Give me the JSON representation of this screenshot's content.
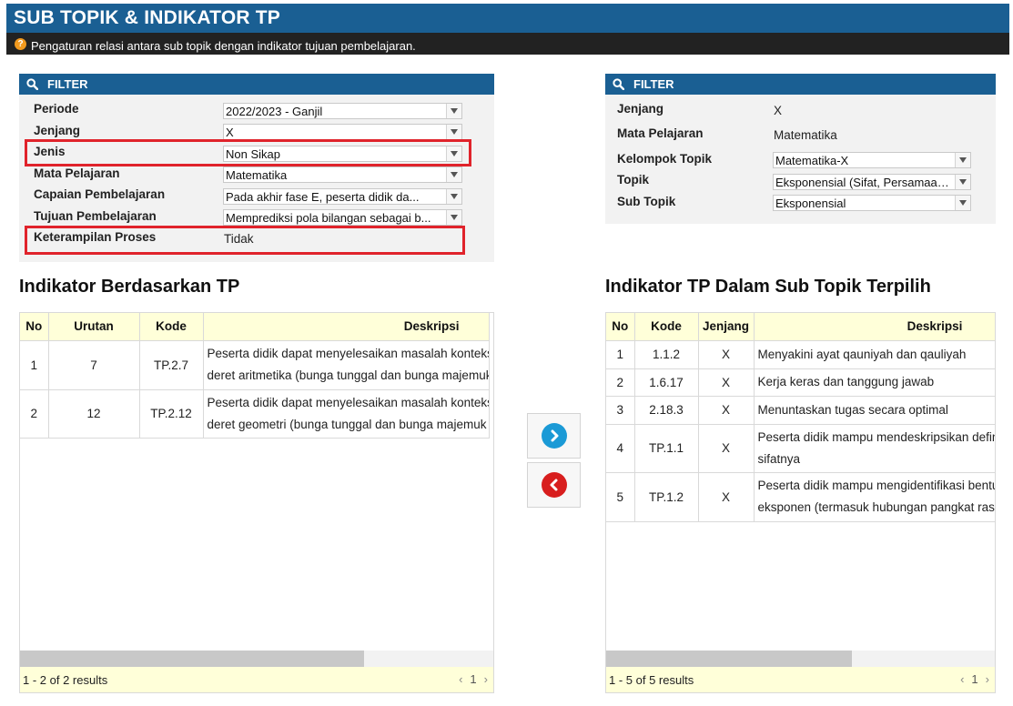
{
  "header": {
    "title": "SUB TOPIK & INDIKATOR TP",
    "help_icon": "question-circle-icon",
    "subtitle": "Pengaturan relasi antara sub topik dengan indikator tujuan pembelajaran."
  },
  "left_filter": {
    "title": "FILTER",
    "search_icon": "search-icon",
    "periode_label": "Periode",
    "periode_value": "2022/2023 - Ganjil",
    "jenjang_label": "Jenjang",
    "jenjang_value": "X",
    "jenis_label": "Jenis",
    "jenis_value": "Non Sikap",
    "mapel_label": "Mata Pelajaran",
    "mapel_value": "Matematika",
    "cp_label": "Capaian Pembelajaran",
    "cp_value": "Pada akhir fase E, peserta didik da...",
    "tp_label": "Tujuan Pembelajaran",
    "tp_value": "Memprediksi pola bilangan sebagai b...",
    "kp_label": "Keterampilan Proses",
    "kp_value": "Tidak",
    "highlight_color": "#e0232b"
  },
  "right_filter": {
    "title": "FILTER",
    "jenjang_label": "Jenjang",
    "jenjang_value": "X",
    "mapel_label": "Mata Pelajaran",
    "mapel_value": "Matematika",
    "kelompok_label": "Kelompok Topik",
    "kelompok_value": "Matematika-X",
    "topik_label": "Topik",
    "topik_value": "Eksponensial (Sifat, Persamaan...",
    "subtopik_label": "Sub Topik",
    "subtopik_value": "Eksponensial"
  },
  "left_grid": {
    "section_title": "Indikator Berdasarkan TP",
    "headers": {
      "no": "No",
      "urutan": "Urutan",
      "kode": "Kode",
      "deskripsi": "Deskripsi"
    },
    "rows": [
      {
        "no": "1",
        "urutan": "7",
        "kode": "TP.2.7",
        "desc1": "Peserta didik dapat menyelesaikan masalah konteks",
        "desc2": "deret aritmetika (bunga tunggal dan bunga majemuk"
      },
      {
        "no": "2",
        "urutan": "12",
        "kode": "TP.2.12",
        "desc1": "Peserta didik dapat menyelesaikan masalah konteks",
        "desc2": "deret geometri (bunga tunggal dan bunga majemuk"
      }
    ],
    "footer": "1 - 2 of 2 results",
    "page": "1",
    "prev": "‹",
    "next": "›",
    "scroll_fraction": 0.73
  },
  "right_grid": {
    "section_title": "Indikator TP Dalam Sub Topik Terpilih",
    "headers": {
      "no": "No",
      "kode": "Kode",
      "jenjang": "Jenjang",
      "deskripsi": "Deskripsi"
    },
    "rows": [
      {
        "no": "1",
        "kode": "1.1.2",
        "jenjang": "X",
        "desc1": "Menyakini ayat qauniyah dan qauliyah",
        "desc2": ""
      },
      {
        "no": "2",
        "kode": "1.6.17",
        "jenjang": "X",
        "desc1": "Kerja keras dan tanggung jawab",
        "desc2": ""
      },
      {
        "no": "3",
        "kode": "2.18.3",
        "jenjang": "X",
        "desc1": "Menuntaskan tugas secara optimal",
        "desc2": ""
      },
      {
        "no": "4",
        "kode": "TP.1.1",
        "jenjang": "X",
        "desc1": "Peserta didik mampu mendeskripsikan definisi",
        "desc2": "sifatnya"
      },
      {
        "no": "5",
        "kode": "TP.1.2",
        "jenjang": "X",
        "desc1": "Peserta didik mampu mengidentifikasi bentuk",
        "desc2": "eksponen (termasuk hubungan pangkat rasional"
      }
    ],
    "footer": "1 - 5 of 5 results",
    "page": "1",
    "prev": "‹",
    "next": "›",
    "scroll_fraction": 0.6
  },
  "actions": {
    "add_icon": "chevron-right-circle-icon",
    "add_color": "#1b9ad6",
    "remove_icon": "chevron-left-circle-icon",
    "remove_color": "#d81e1e"
  }
}
